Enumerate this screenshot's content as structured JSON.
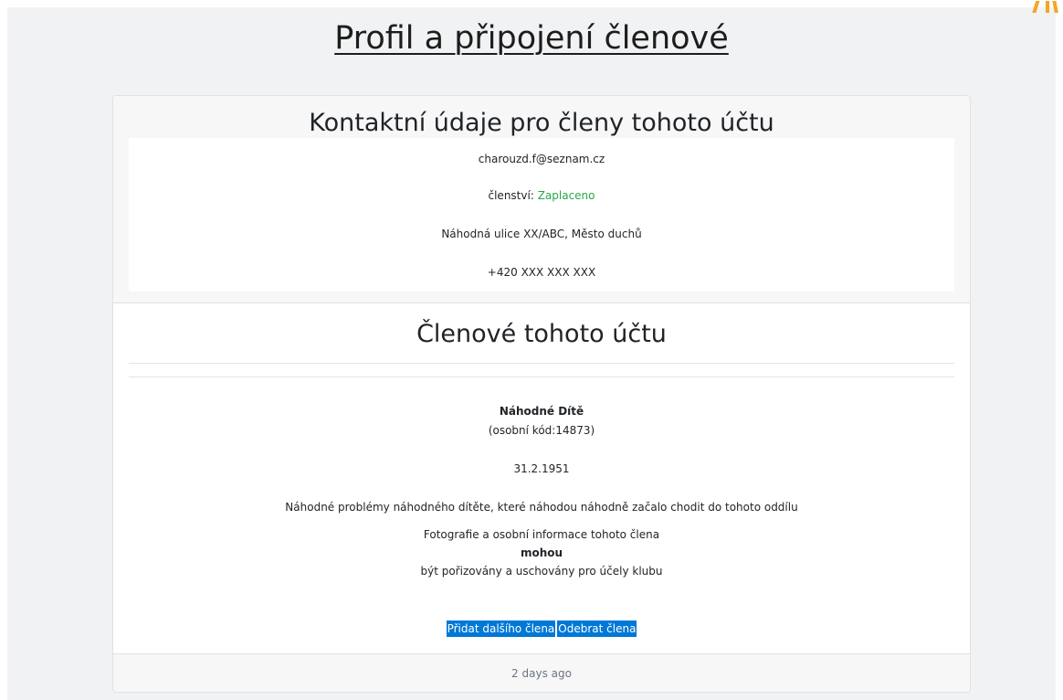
{
  "page": {
    "title": "Profil a připojení členové"
  },
  "contact": {
    "title": "Kontaktní údaje pro členy tohoto účtu",
    "email": "charouzd.f@seznam.cz",
    "membership_label": "členství:",
    "membership_status": "Zaplaceno",
    "address": "Náhodná ulice XX/ABC, Město duchů",
    "phone": "+420 XXX XXX XXX"
  },
  "members": {
    "title": "Členové tohoto účtu",
    "list": [
      {
        "name": "Náhodné Dítě",
        "code": "(osobní kód:14873)",
        "birthdate": "31.2.1951",
        "notes": "Náhodné problémy náhodného dítěte, které náhodou náhodně začalo chodit do tohoto oddílu",
        "photo_consent_prefix": "Fotografie a osobní informace tohoto člena",
        "photo_consent_value": "mohou",
        "photo_consent_suffix": "být pořizovány a uschovány pro účely klubu"
      }
    ]
  },
  "actions": {
    "add_member": "Přidat dalšího člena",
    "remove_member": "Odebrat člena"
  },
  "footer": {
    "timestamp": "2 days ago"
  },
  "colors": {
    "paid_status": "#28a745",
    "button": "#0078d7",
    "corner_decoration": "#f5a425"
  }
}
